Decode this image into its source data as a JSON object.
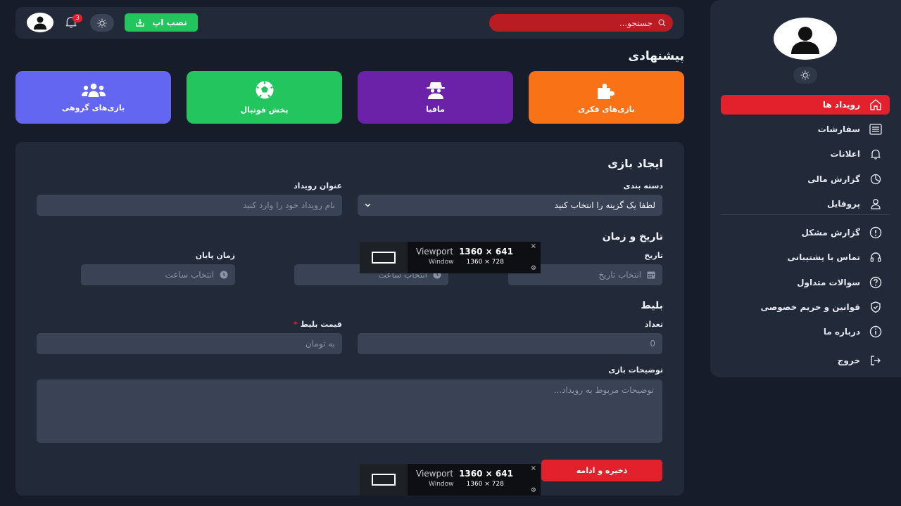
{
  "sidebar": {
    "items": [
      {
        "label": "رویداد ها",
        "icon": "home-icon",
        "active": true
      },
      {
        "label": "سفارشات",
        "icon": "list-icon"
      },
      {
        "label": "اعلانات",
        "icon": "bell-icon"
      },
      {
        "label": "گزارش مالی",
        "icon": "pie-chart-icon"
      },
      {
        "label": "پروفایل",
        "icon": "user-icon"
      },
      {
        "label": "گزارش مشکل",
        "icon": "alert-circle-icon"
      },
      {
        "label": "تماس با پشتیبانی",
        "icon": "headset-icon"
      },
      {
        "label": "سوالات متداول",
        "icon": "help-circle-icon"
      },
      {
        "label": "قوانین و حریم خصوصی",
        "icon": "shield-icon"
      },
      {
        "label": "درباره ما",
        "icon": "info-icon"
      },
      {
        "label": "خروج",
        "icon": "logout-icon"
      }
    ]
  },
  "header": {
    "search_placeholder": "جستجو...",
    "notification_count": "3",
    "install_label": "نصب اپ"
  },
  "suggested": {
    "title": "پیشنهادی",
    "cards": [
      {
        "label": "بازی‌های فکری",
        "color": "#f97316",
        "icon": "puzzle-icon"
      },
      {
        "label": "مافیا",
        "color": "#6b21a8",
        "icon": "spy-icon"
      },
      {
        "label": "پخش فوتبال",
        "color": "#22c55e",
        "icon": "soccer-ball-icon"
      },
      {
        "label": "بازی‌های گروهی",
        "color": "#6366f1",
        "icon": "users-icon"
      }
    ]
  },
  "form": {
    "title": "ایجاد بازی",
    "category_label": "دسته بندی",
    "category_value": "لطفا یک گزینه را انتخاب کنید",
    "event_title_label": "عنوان رویداد",
    "event_title_placeholder": "نام رویداد خود را وارد کنید",
    "datetime_title": "تاریخ و زمان",
    "date_label": "تاریخ",
    "date_placeholder": "انتخاب تاریخ",
    "start_time_placeholder": "انتخاب ساعت",
    "end_time_label": "زمان پایان",
    "end_time_placeholder": "انتخاب ساعت",
    "ticket_title": "بلیط",
    "count_label": "تعداد",
    "count_value": "0",
    "price_label": "قیمت بلیط",
    "price_required": "*",
    "price_placeholder": "به تومان",
    "description_label": "توضیحات بازی",
    "description_placeholder": "توضیحات مربوط به رویداد...",
    "save_label": "ذخیره و ادامه"
  },
  "viewport_overlay": {
    "viewport_label": "Viewport",
    "viewport_size": "1360 × 641",
    "window_label": "Window",
    "window_size": "1360 × 728",
    "close": "×",
    "settings": "⚙"
  },
  "colors": {
    "background": "#161c2a",
    "panel": "#222a3a",
    "input": "#3a4356",
    "accent_red": "#e3212d",
    "install_green": "#22c55e"
  }
}
